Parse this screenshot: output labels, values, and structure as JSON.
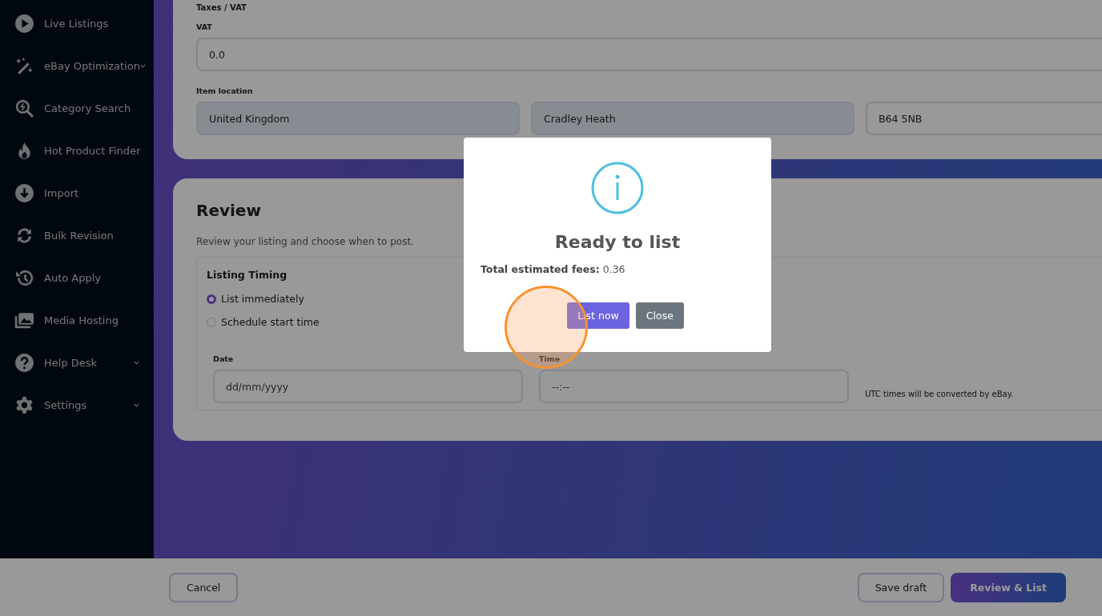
{
  "sidebar": {
    "items": [
      {
        "label": "Live Listings",
        "expandable": false
      },
      {
        "label": "eBay Optimization",
        "expandable": true
      },
      {
        "label": "Category Search",
        "expandable": false
      },
      {
        "label": "Hot Product Finder",
        "expandable": false
      },
      {
        "label": "Import",
        "expandable": false
      },
      {
        "label": "Bulk Revision",
        "expandable": false
      },
      {
        "label": "Auto Apply",
        "expandable": false
      },
      {
        "label": "Media Hosting",
        "expandable": false
      },
      {
        "label": "Help Desk",
        "expandable": true
      },
      {
        "label": "Settings",
        "expandable": true
      }
    ]
  },
  "details_card": {
    "section_title": "Taxes / VAT",
    "vat": {
      "label": "VAT",
      "value": "0.0"
    },
    "item_location": {
      "label": "Item location",
      "fields": [
        {
          "value": "United Kingdom",
          "disabled": true
        },
        {
          "value": "Cradley Heath",
          "disabled": true
        },
        {
          "value": "B64 5NB",
          "disabled": false
        }
      ]
    }
  },
  "review_card": {
    "title": "Review",
    "subtitle": "Review your listing and choose when to post.",
    "timing": {
      "title": "Listing Timing",
      "options": [
        {
          "label": "List immediately",
          "selected": true
        },
        {
          "label": "Schedule start time",
          "selected": false
        }
      ],
      "date": {
        "label": "Date",
        "placeholder": "dd/mm/yyyy"
      },
      "time": {
        "label": "Time",
        "placeholder": "--:--"
      },
      "note": "UTC times will be converted by eBay."
    }
  },
  "footer": {
    "cancel": "Cancel",
    "save_draft": "Save draft",
    "review_list": "Review & List"
  },
  "modal": {
    "title": "Ready to list",
    "fees_label": "Total estimated fees:",
    "fees_value": "0.36",
    "buttons": [
      "List now",
      "Close"
    ]
  }
}
